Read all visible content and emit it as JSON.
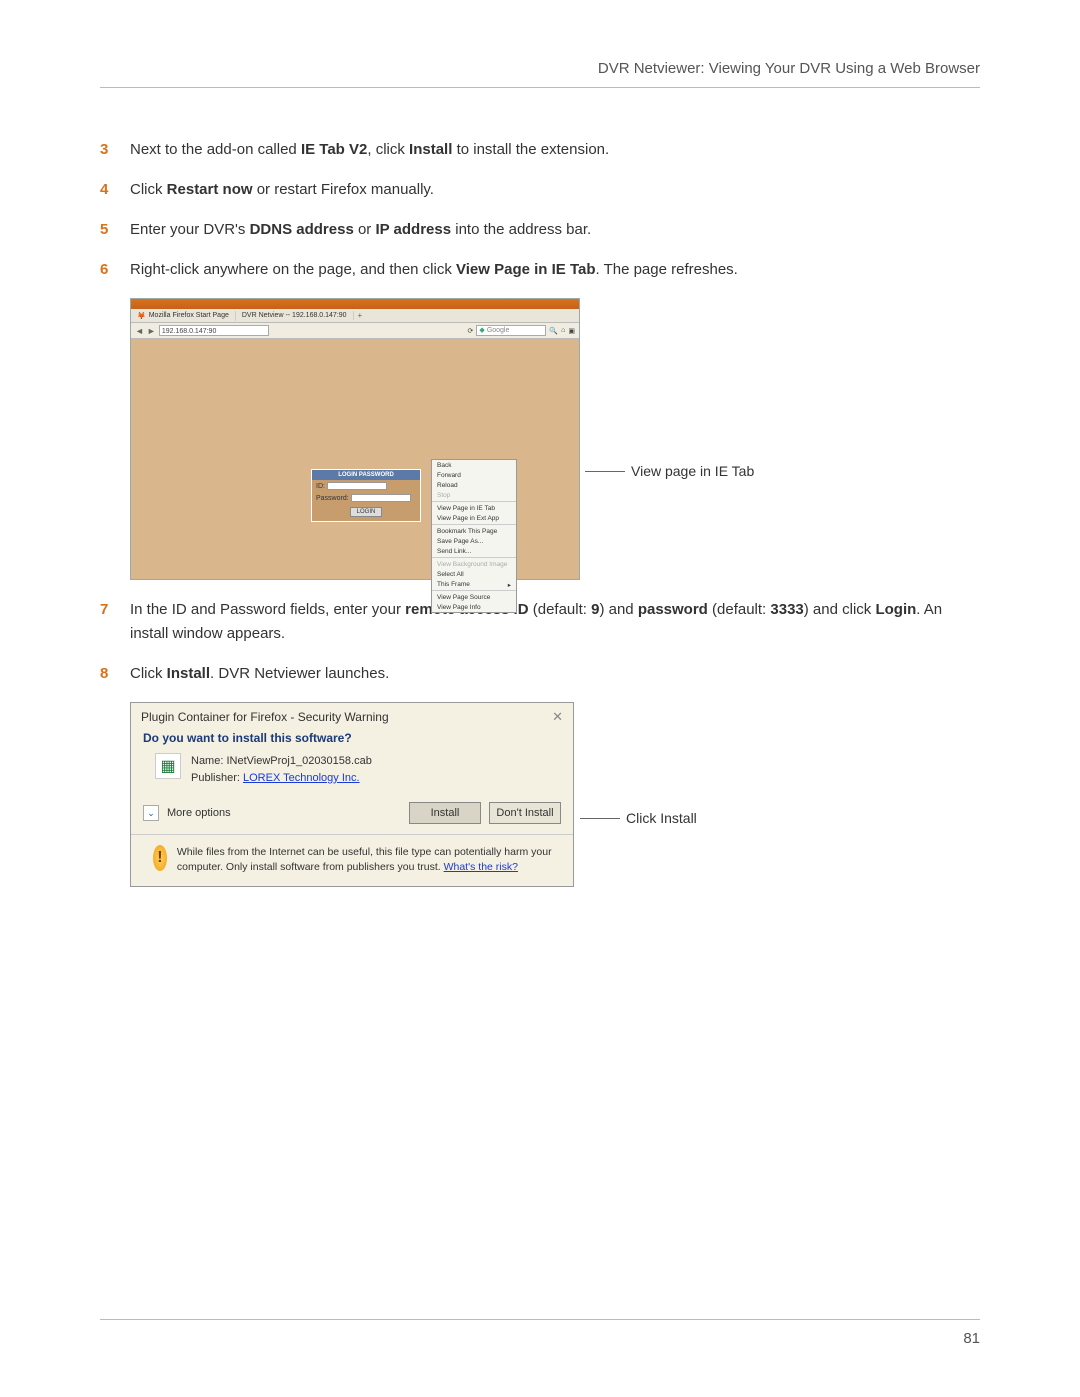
{
  "header": {
    "title": "DVR Netviewer: Viewing Your DVR Using a Web Browser"
  },
  "steps": {
    "s3": {
      "num": "3",
      "pre": "Next to the add-on called ",
      "b1": "IE Tab V2",
      "mid1": ", click ",
      "b2": "Install",
      "post": " to install the extension."
    },
    "s4": {
      "num": "4",
      "pre": "Click ",
      "b1": "Restart now",
      "post": " or restart Firefox manually."
    },
    "s5": {
      "num": "5",
      "pre": "Enter your DVR's ",
      "b1": "DDNS address",
      "mid1": " or ",
      "b2": "IP address",
      "post": " into the address bar."
    },
    "s6": {
      "num": "6",
      "pre": "Right-click anywhere on the page, and then click ",
      "b1": "View Page in IE Tab",
      "post": ". The page refreshes."
    },
    "s7": {
      "num": "7",
      "pre": "In the ID and Password fields, enter your ",
      "b1": "remote access ID",
      "mid1": " (default: ",
      "b2": "9",
      "mid2": ") and ",
      "b3": "password",
      "post1": " (default: ",
      "b4": "3333",
      "mid3": ") and click ",
      "b5": "Login",
      "post2": ". An install window appears."
    },
    "s8": {
      "num": "8",
      "pre": "Click ",
      "b1": "Install",
      "post": ". DVR Netviewer launches."
    }
  },
  "fig1": {
    "tab1": "Mozilla Firefox Start Page",
    "tab2": "DVR Netview -- 192.168.0.147:90",
    "addr": "192.168.0.147:90",
    "search_placeholder": "Google",
    "login_header": "LOGIN PASSWORD",
    "id_label": "ID:",
    "pw_label": "Password:",
    "login_btn": "LOGIN",
    "ctx": {
      "back": "Back",
      "forward": "Forward",
      "reload": "Reload",
      "stop": "Stop",
      "vietab": "View Page in IE Tab",
      "viapp": "View Page in Ext App",
      "bookmark": "Bookmark This Page",
      "saveas": "Save Page As...",
      "sendlink": "Send Link...",
      "viewbg": "View Background Image",
      "selectall": "Select All",
      "frame": "This Frame",
      "source": "View Page Source",
      "info": "View Page Info"
    },
    "annot": "View page in IE Tab"
  },
  "fig2": {
    "title": "Plugin Container for Firefox - Security Warning",
    "question": "Do you want to install this software?",
    "name_lbl": "Name:",
    "name_val": "INetViewProj1_02030158.cab",
    "pub_lbl": "Publisher:",
    "pub_val": "LOREX Technology Inc.",
    "more": "More options",
    "install_btn": "Install",
    "dont_btn": "Don't Install",
    "warn_text": "While files from the Internet can be useful, this file type can potentially harm your computer. Only install software from publishers you trust. ",
    "warn_link": "What's the risk?",
    "annot": "Click Install"
  },
  "footer": {
    "page": "81"
  }
}
